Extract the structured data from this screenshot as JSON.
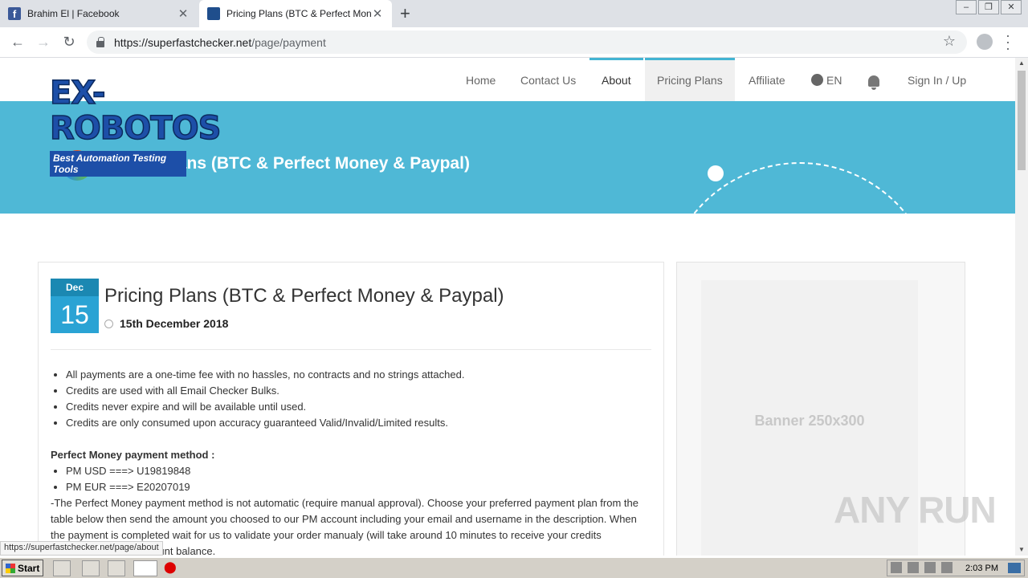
{
  "browser": {
    "tabs": [
      {
        "title": "Brahim El | Facebook",
        "active": false
      },
      {
        "title": "Pricing Plans (BTC & Perfect Money & Paypal)",
        "active": true
      }
    ],
    "url_host": "https://superfastchecker.net",
    "url_path": "/page/payment",
    "status_url": "https://superfastchecker.net/page/about"
  },
  "site": {
    "logo_main": "EX-ROBOTOS",
    "logo_sub": "Best Automation Testing Tools",
    "nav": [
      "Home",
      "Contact Us",
      "About",
      "Pricing Plans",
      "Affiliate",
      "EN",
      "Sign In / Up"
    ],
    "banner_title": "Pricing Plans (BTC & Perfect Money & Paypal)"
  },
  "post": {
    "month": "Dec",
    "day": "15",
    "title": "Pricing Plans (BTC & Perfect Money & Paypal)",
    "date": "15th December 2018",
    "bullets": [
      "All payments are a one-time fee with no hassles, no contracts and no strings attached.",
      "Credits are used with all Email Checker Bulks.",
      "Credits never expire and will be available until used.",
      "Credits are only consumed upon accuracy guaranteed Valid/Invalid/Limited results."
    ],
    "pm_heading": "Perfect Money payment method :",
    "pm_accounts": [
      "PM USD ===> U19819848",
      "PM EUR ===> E20207019"
    ],
    "pm_note": "-The Perfect Money payment method is not automatic (require manual approval). Choose your preferred payment plan from the table below then send the amount you choosed to our PM account including your email and username in the description. When the payment is completed wait for us to validate your order manualy (will take around 10 minutes to receive your credits purchased in your account balance."
  },
  "sidebar": {
    "banner": "Banner  250x300"
  },
  "watermark": "ANY RUN",
  "taskbar": {
    "start": "Start",
    "time": "2:03 PM"
  }
}
